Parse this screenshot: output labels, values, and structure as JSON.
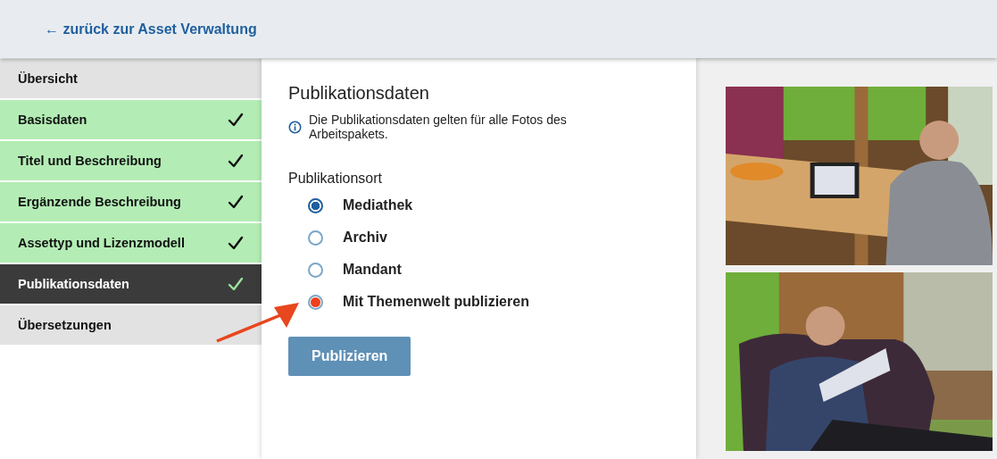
{
  "header": {
    "back_link": "← zurück zur Asset Verwaltung"
  },
  "sidebar": {
    "items": [
      {
        "label": "Übersicht",
        "done": false,
        "selected": false
      },
      {
        "label": "Basisdaten",
        "done": true,
        "selected": false
      },
      {
        "label": "Titel und Beschreibung",
        "done": true,
        "selected": false
      },
      {
        "label": "Ergänzende Beschreibung",
        "done": true,
        "selected": false
      },
      {
        "label": "Assettyp und Lizenzmodell",
        "done": true,
        "selected": false
      },
      {
        "label": "Publikationsdaten",
        "done": true,
        "selected": true
      },
      {
        "label": "Übersetzungen",
        "done": false,
        "selected": false
      }
    ]
  },
  "form": {
    "title": "Publikationsdaten",
    "info": "Die Publikationsdaten gelten für alle Fotos des Arbeitspakets.",
    "group_label": "Publikationsort",
    "options": [
      {
        "label": "Mediathek",
        "selected": true,
        "highlighted": false
      },
      {
        "label": "Archiv",
        "selected": false,
        "highlighted": false
      },
      {
        "label": "Mandant",
        "selected": false,
        "highlighted": false
      },
      {
        "label": "Mit Themenwelt publizieren",
        "selected": false,
        "highlighted": true
      }
    ],
    "submit": "Publizieren"
  }
}
